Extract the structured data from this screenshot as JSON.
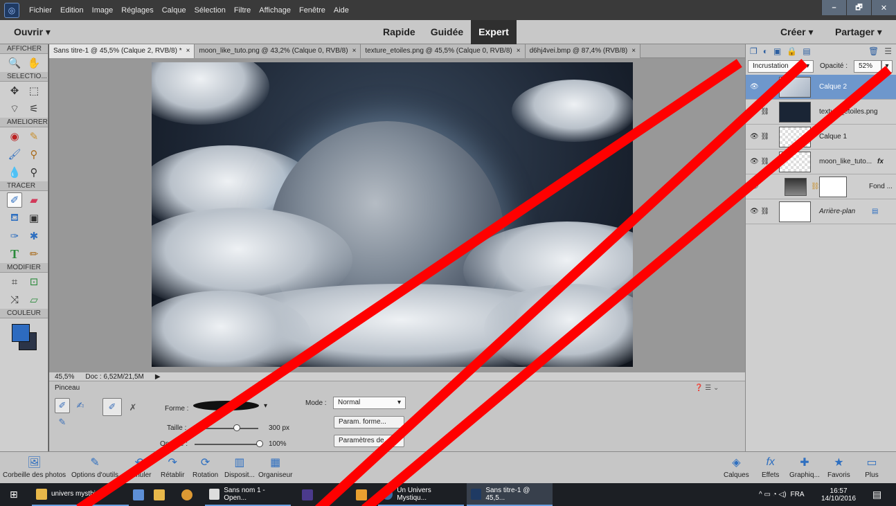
{
  "menu": {
    "items": [
      "Fichier",
      "Edition",
      "Image",
      "Réglages",
      "Calque",
      "Sélection",
      "Filtre",
      "Affichage",
      "Fenêtre",
      "Aide"
    ]
  },
  "window_buttons": {
    "minimize": "–",
    "restore": "🗗",
    "close": "✕"
  },
  "modebar": {
    "ouvrir": "Ouvrir ▾",
    "modes": [
      "Rapide",
      "Guidée",
      "Expert"
    ],
    "active_mode": "Expert",
    "creer": "Créer ▾",
    "partager": "Partager ▾"
  },
  "toolbox": {
    "sections": [
      "AFFICHER",
      "SELECTIO...",
      "AMELIORER",
      "TRACER",
      "MODIFIER",
      "COULEUR"
    ],
    "fg_color": "#2d6bc0",
    "bg_color": "#2b3448"
  },
  "tabs": [
    {
      "label": "Sans titre-1 @ 45,5% (Calque 2, RVB/8) *",
      "active": true
    },
    {
      "label": "moon_like_tuto.png @ 43,2% (Calque 0, RVB/8)",
      "active": false
    },
    {
      "label": "texture_etoiles.png @ 45,5% (Calque 0, RVB/8)",
      "active": false
    },
    {
      "label": "d6hj4vei.bmp @ 87,4% (RVB/8)",
      "active": false
    }
  ],
  "status": {
    "zoom": "45,5%",
    "doc": "Doc : 6,52M/21,5M"
  },
  "options": {
    "tool_name": "Pinceau",
    "forme_label": "Forme :",
    "taille_label": "Taille :",
    "taille_value": "300 px",
    "opacite_label": "Opacité :",
    "opacite_value": "100%",
    "mode_label": "Mode :",
    "mode_value": "Normal",
    "param_forme_btn": "Param. forme...",
    "parametres_btn": "Paramètres de..."
  },
  "layers_panel": {
    "blend_mode": "Incrustation",
    "opacity_label": "Opacité :",
    "opacity_value": "52%",
    "layers": [
      {
        "name": "Calque 2",
        "active": true
      },
      {
        "name": "texture_etoiles.png",
        "active": false
      },
      {
        "name": "Calque 1",
        "active": false
      },
      {
        "name": "moon_like_tuto...",
        "active": false
      },
      {
        "name": "Fond ...",
        "active": false
      },
      {
        "name": "Arrière-plan",
        "active": false
      }
    ]
  },
  "panelbar": {
    "left": [
      "Corbeille des photos",
      "Options d'outils",
      "Annuler",
      "Rétablir",
      "Rotation",
      "Disposit...",
      "Organiseur"
    ],
    "right": [
      "Calques",
      "Effets",
      "Graphiq...",
      "Favoris",
      "Plus"
    ]
  },
  "taskbar": {
    "items": [
      "univers mysthi...",
      "Sans nom 1 - Open...",
      "Un Univers Mystiqu...",
      "Sans titre-1 @ 45,5..."
    ],
    "tray": "FRA",
    "time": "16:57",
    "date": "14/10/2016"
  },
  "overlay_color": "#ff0000"
}
